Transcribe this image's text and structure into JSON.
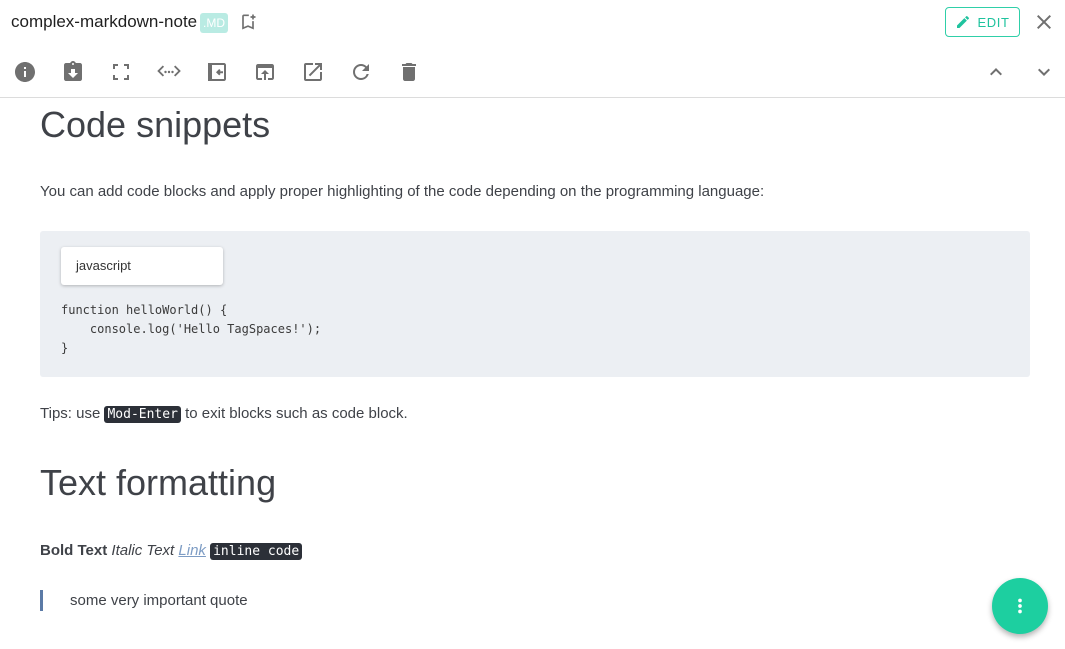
{
  "header": {
    "file_name": "complex-markdown-note",
    "extension": ".MD",
    "edit_label": "EDIT",
    "accent_color": "#1fc39e"
  },
  "toolbar": {
    "icons": [
      "info-icon",
      "download-icon",
      "fullscreen-icon",
      "code-view-icon",
      "exit-icon",
      "open-parent-icon",
      "open-external-icon",
      "reload-icon",
      "delete-icon",
      "chevron-up-icon",
      "chevron-down-icon"
    ]
  },
  "document": {
    "heading_code": "Code snippets",
    "intro": "You can add code blocks and apply proper highlighting of the code depending on the programming language:",
    "code_language": "javascript",
    "code": "function helloWorld() {\n    console.log('Hello TagSpaces!');\n}",
    "tips_prefix": "Tips: use ",
    "tips_key": "Mod-Enter",
    "tips_suffix": " to exit blocks such as code block.",
    "heading_text": "Text formatting",
    "bold_text": "Bold Text",
    "italic_text": "Italic Text",
    "link_text": "Link",
    "inline_code": "inline code",
    "quote": "some very important quote"
  },
  "fab": {
    "icon": "more-vert-icon",
    "color": "#1dcfa0"
  }
}
